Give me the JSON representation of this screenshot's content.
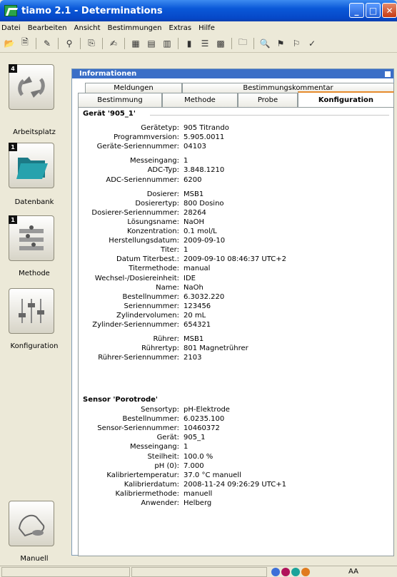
{
  "window": {
    "title": "tiamo 2.1 - Determinations",
    "minimize": "_",
    "maximize": "□",
    "close": "✕"
  },
  "menu": [
    "Datei",
    "Bearbeiten",
    "Ansicht",
    "Bestimmungen",
    "Extras",
    "Hilfe"
  ],
  "sidebar": [
    {
      "label": "Arbeitsplatz",
      "badge": "4",
      "icon": "workplace-icon"
    },
    {
      "label": "Datenbank",
      "badge": "1",
      "icon": "database-folder-icon"
    },
    {
      "label": "Methode",
      "badge": "1",
      "icon": "method-icon"
    },
    {
      "label": "Konfiguration",
      "badge": "",
      "icon": "configuration-sliders-icon"
    },
    {
      "label": "Manuell",
      "badge": "",
      "icon": "manual-hand-icon"
    }
  ],
  "panel": {
    "title": "Informationen",
    "tabs_top": [
      "Meldungen",
      "Bestimmungskommentar"
    ],
    "tabs_bottom": [
      "Bestimmung",
      "Methode",
      "Probe",
      "Konfiguration"
    ]
  },
  "device": {
    "section": "Gerät '905_1'",
    "rows": [
      [
        "Gerätetyp:",
        "905 Titrando"
      ],
      [
        "Programmversion:",
        "5.905.0011"
      ],
      [
        "Geräte-Seriennummer:",
        "04103"
      ],
      [
        "Messeingang:",
        "1"
      ],
      [
        "ADC-Typ:",
        "3.848.1210"
      ],
      [
        "ADC-Seriennummer:",
        "6200"
      ],
      [
        "Dosierer:",
        "MSB1"
      ],
      [
        "Dosierertyp:",
        "800 Dosino"
      ],
      [
        "Dosierer-Seriennummer:",
        "28264"
      ],
      [
        "Lösungsname:",
        "NaOH"
      ],
      [
        "Konzentration:",
        "0.1 mol/L"
      ],
      [
        "Herstellungsdatum:",
        "2009-09-10"
      ],
      [
        "Titer:",
        "1"
      ],
      [
        "Datum Titerbest.:",
        "2009-09-10 08:46:37 UTC+2"
      ],
      [
        "Titermethode:",
        "manual"
      ],
      [
        "Wechsel-/Dosiereinheit:",
        "IDE"
      ],
      [
        "Name:",
        "NaOh"
      ],
      [
        "Bestellnummer:",
        "6.3032.220"
      ],
      [
        "Seriennummer:",
        "123456"
      ],
      [
        "Zylindervolumen:",
        "20 mL"
      ],
      [
        "Zylinder-Seriennummer:",
        "654321"
      ],
      [
        "Rührer:",
        "MSB1"
      ],
      [
        "Rührertyp:",
        "801 Magnetrührer"
      ],
      [
        "Rührer-Seriennummer:",
        "2103"
      ]
    ]
  },
  "sensor": {
    "section": "Sensor 'Porotrode'",
    "rows": [
      [
        "Sensortyp:",
        "pH-Elektrode"
      ],
      [
        "Bestellnummer:",
        "6.0235.100"
      ],
      [
        "Sensor-Seriennummer:",
        "10460372"
      ],
      [
        "Gerät:",
        "905_1"
      ],
      [
        "Messeingang:",
        "1"
      ],
      [
        "Steilheit:",
        "100.0 %"
      ],
      [
        "pH (0):",
        "7.000"
      ],
      [
        "Kalibriertemperatur:",
        "37.0 °C manuell"
      ],
      [
        "Kalibrierdatum:",
        "2008-11-24 09:26:29 UTC+1"
      ],
      [
        "Kalibriermethode:",
        "manuell"
      ],
      [
        "Anwender:",
        "Helberg"
      ]
    ]
  },
  "status": {
    "text": "AA",
    "dot_colors": [
      "#3c6fd8",
      "#b0125a",
      "#1aa39a",
      "#e07a1e"
    ]
  }
}
